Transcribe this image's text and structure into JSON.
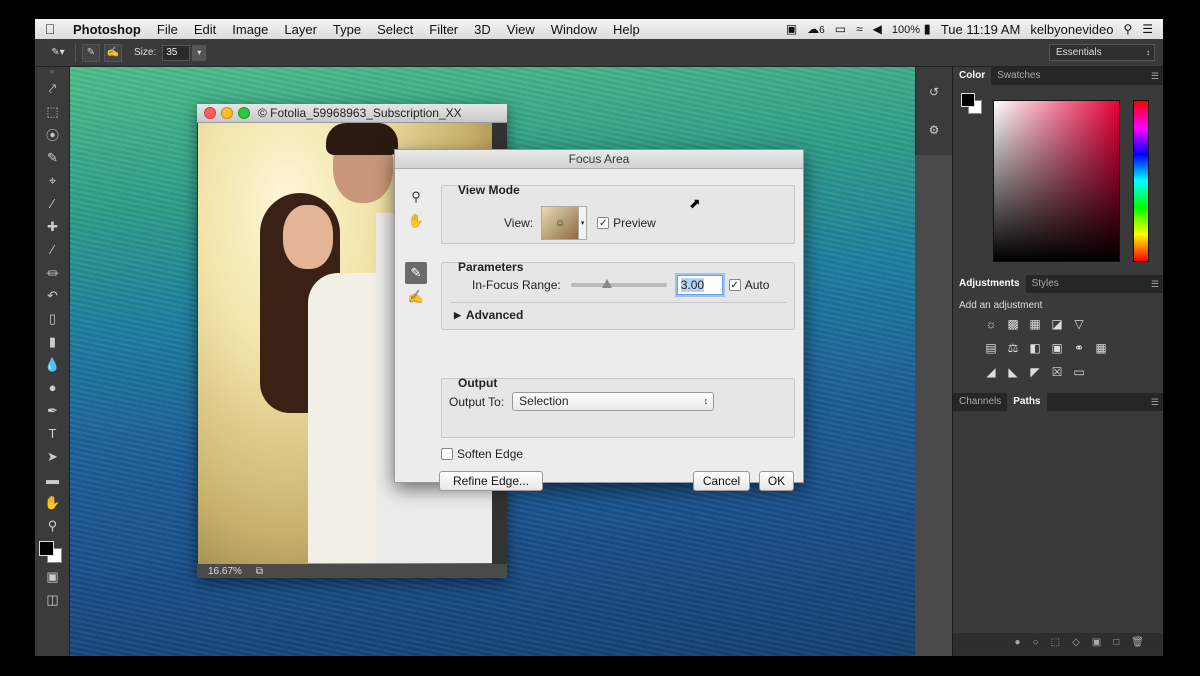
{
  "menubar": {
    "apple_icon": "apple-logo-icon",
    "app_name": "Photoshop",
    "items": [
      "File",
      "Edit",
      "Image",
      "Layer",
      "Type",
      "Select",
      "Filter",
      "3D",
      "View",
      "Window",
      "Help"
    ],
    "status": {
      "notification_count": "6",
      "battery": "100%",
      "clock": "Tue 11:19 AM",
      "user": "kelbyonevideo"
    }
  },
  "options_bar": {
    "size_label": "Size:",
    "size_value": "35",
    "workspace": "Essentials"
  },
  "document": {
    "title": "© Fotolia_59968963_Subscription_XX",
    "zoom": "16.67%"
  },
  "dialog": {
    "title": "Focus Area",
    "view_mode": {
      "heading": "View Mode",
      "view_label": "View:",
      "preview_label": "Preview",
      "preview_checked": true
    },
    "parameters": {
      "heading": "Parameters",
      "range_label": "In-Focus Range:",
      "range_value": "3.00",
      "range_fraction": 0.38,
      "auto_label": "Auto",
      "auto_checked": true,
      "advanced_label": "Advanced"
    },
    "output": {
      "heading": "Output",
      "output_to_label": "Output To:",
      "output_to_value": "Selection"
    },
    "soften_edge_label": "Soften Edge",
    "soften_edge_checked": false,
    "refine_edge_label": "Refine Edge...",
    "cancel_label": "Cancel",
    "ok_label": "OK"
  },
  "panels": {
    "color_tabs": [
      "Color",
      "Swatches"
    ],
    "adjust_tabs": [
      "Adjustments",
      "Styles"
    ],
    "adjust_title": "Add an adjustment",
    "paths_tabs": [
      "Channels",
      "Paths"
    ]
  },
  "colors": {
    "accent_red": "#e8003a",
    "selection_blue": "#b5d3f5"
  }
}
